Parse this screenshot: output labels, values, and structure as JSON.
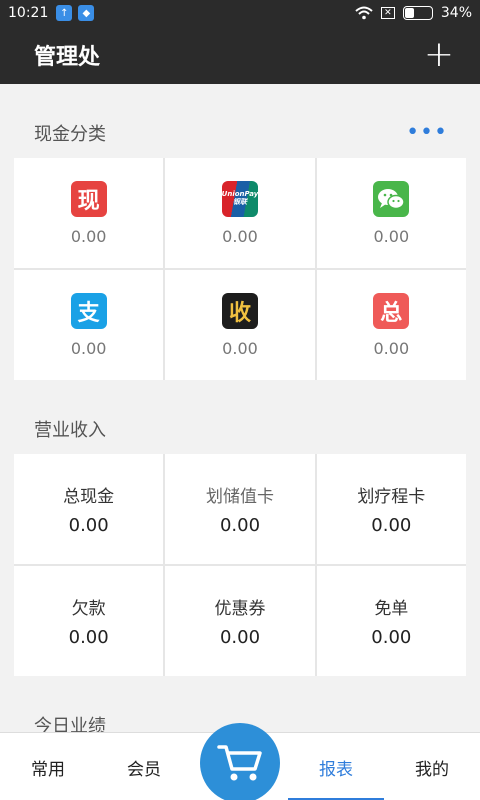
{
  "status_bar": {
    "time": "10:21",
    "battery": "34%",
    "battery_level": 0.34
  },
  "app_bar": {
    "title": "管理处",
    "add_label": "+"
  },
  "cash_section": {
    "title": "现金分类",
    "more_label": "•••",
    "items": [
      {
        "icon": "cash-icon",
        "glyph": "现",
        "value": "0.00"
      },
      {
        "icon": "unionpay-icon",
        "glyph": "UnionPay",
        "glyph2": "银联",
        "value": "0.00"
      },
      {
        "icon": "wechat-icon",
        "value": "0.00"
      },
      {
        "icon": "alipay-icon",
        "glyph": "支",
        "value": "0.00"
      },
      {
        "icon": "shou-icon",
        "glyph": "收",
        "value": "0.00"
      },
      {
        "icon": "total-icon",
        "glyph": "总",
        "value": "0.00"
      }
    ]
  },
  "revenue_section": {
    "title": "营业收入",
    "items": [
      {
        "label": "总现金",
        "value": "0.00"
      },
      {
        "label": "划储值卡",
        "value": "0.00"
      },
      {
        "label": "划疗程卡",
        "value": "0.00"
      },
      {
        "label": "欠款",
        "value": "0.00"
      },
      {
        "label": "优惠券",
        "value": "0.00"
      },
      {
        "label": "免单",
        "value": "0.00"
      }
    ]
  },
  "today_section": {
    "title": "今日业绩"
  },
  "bottom_nav": {
    "items": [
      {
        "label": "常用"
      },
      {
        "label": "会员"
      },
      {
        "label": ""
      },
      {
        "label": "报表"
      },
      {
        "label": "我的"
      }
    ],
    "active": "报表"
  },
  "colors": {
    "accent": "#2f7ddb",
    "header": "#2b2b2b",
    "cart": "#2d8fd8"
  }
}
